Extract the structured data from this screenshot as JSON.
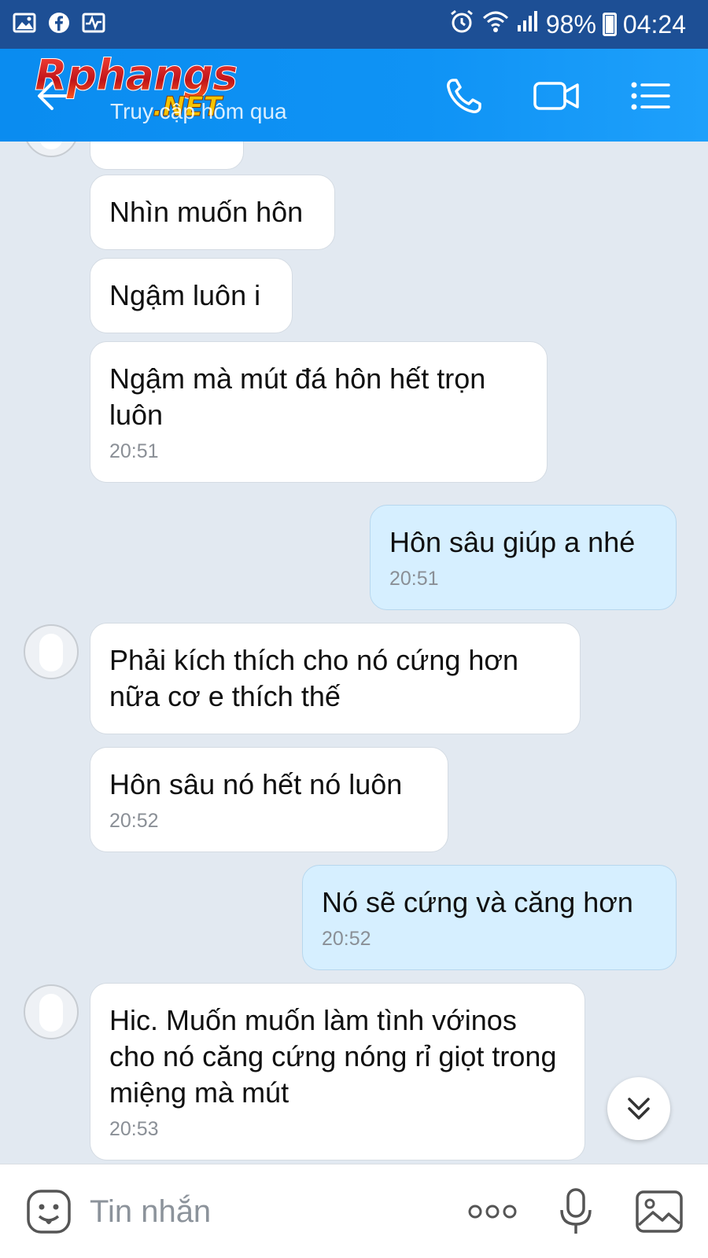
{
  "status_bar": {
    "icons_left": [
      "gallery-icon",
      "facebook-icon",
      "activity-icon"
    ],
    "icons_right": [
      "alarm-icon",
      "wifi-icon",
      "signal-icon"
    ],
    "battery": "98%",
    "time": "04:24"
  },
  "header": {
    "logo_text": "Rphangs",
    "logo_suffix": ".NET",
    "subtitle": "Truy cập hôm qua",
    "icons": [
      "back-arrow-icon",
      "phone-icon",
      "video-camera-icon",
      "menu-list-icon"
    ]
  },
  "messages": [
    {
      "side": "in",
      "text": "",
      "time": ""
    },
    {
      "side": "in",
      "text": "Nhìn muốn hôn",
      "time": ""
    },
    {
      "side": "in",
      "text": "Ngậm luôn i",
      "time": ""
    },
    {
      "side": "in",
      "text": "Ngậm mà mút đá hôn hết trọn luôn",
      "time": "20:51"
    },
    {
      "side": "out",
      "text": "Hôn sâu giúp a nhé",
      "time": "20:51"
    },
    {
      "side": "in",
      "text": "Phải kích thích cho nó cứng hơn nữa cơ e thích thế",
      "time": ""
    },
    {
      "side": "in",
      "text": "Hôn sâu nó hết nó luôn",
      "time": "20:52"
    },
    {
      "side": "out",
      "text": "Nó sẽ cứng và căng hơn",
      "time": "20:52"
    },
    {
      "side": "in",
      "text": "Hic. Muốn muốn làm tình vớinos cho nó căng cứng nóng rỉ giọt trong miệng mà mút",
      "time": "20:53"
    }
  ],
  "input_bar": {
    "placeholder": "Tin nhắn",
    "icons": [
      "emoji-icon",
      "more-dots-icon",
      "microphone-icon",
      "image-icon"
    ]
  },
  "colors": {
    "status_bar": "#1d4f95",
    "header": "#0f93f5",
    "chat_background": "#e2e9f1",
    "outgoing_bubble": "#d6efff",
    "incoming_bubble": "#ffffff"
  }
}
